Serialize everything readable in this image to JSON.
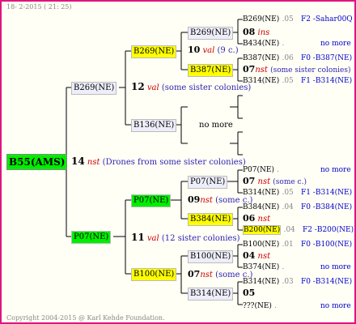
{
  "header": {
    "date": "18-  2-2015 ( 21: 25)"
  },
  "footer": {
    "copyright": "Copyright 2004-2015 @ Karl Kehde Foundation."
  },
  "root": {
    "id": "B55(AMS)"
  },
  "gen1": {
    "sire": {
      "id": "B269(NE)",
      "year": "12",
      "sym": "val",
      "note": "(some sister colonies)"
    },
    "drones": {
      "year": "14",
      "sym": "nst",
      "note": "(Drones from some sister colonies)"
    },
    "dam": {
      "id": "P07(NE)",
      "year": "11",
      "sym": "val",
      "note": "(12 sister colonies)"
    }
  },
  "gen2": {
    "a": {
      "id": "B269(NE)",
      "year": "10",
      "sym": "val",
      "note": "(9 c.)"
    },
    "b": {
      "id": "B136(NE)",
      "note": "no more"
    },
    "c": {
      "id": "P07(NE)",
      "year": "09",
      "sym": "nst",
      "note": "(some c.)"
    },
    "d": {
      "id": "B100(NE)",
      "year": "07",
      "sym": "nst",
      "note": "(some c.)"
    }
  },
  "gen3": {
    "a1": {
      "id": "B269(NE)"
    },
    "a2": {
      "id": "B387(NE)",
      "year": "07",
      "sym": "nst",
      "note": "(some sister colonies)"
    },
    "c1": {
      "id": "P07(NE)"
    },
    "c2": {
      "id": "B384(NE)",
      "year": "06",
      "sym": "nst"
    },
    "d1": {
      "id": "B100(NE)",
      "year": "04",
      "sym": "nst"
    },
    "d2": {
      "id": "B314(NE)",
      "year": "05"
    }
  },
  "gen3_yr": {
    "a1": {
      "year": "08",
      "sym": "ins"
    },
    "c1": {
      "year": "07",
      "sym": "nst",
      "note": "(some c.)"
    }
  },
  "gen4": {
    "r1": {
      "id": "B269(NE)",
      "num": ".05",
      "note": "F2 -Sahar00Q"
    },
    "r2": {
      "id": "B434(NE)",
      "num": ".",
      "note": "no more"
    },
    "r3": {
      "id": "B387(NE)",
      "num": ".06",
      "note": "F0 -B387(NE)"
    },
    "r4": {
      "id": "B314(NE)",
      "num": ".05",
      "note": "F1 -B314(NE)"
    },
    "r5": {
      "id": "P07(NE)",
      "num": ".",
      "note": "no more"
    },
    "r6": {
      "id": "B314(NE)",
      "num": ".05",
      "note": "F1 -B314(NE)"
    },
    "r7": {
      "id": "B384(NE)",
      "num": ".04",
      "note": "F0 -B384(NE)"
    },
    "r8": {
      "id": "B200(NE)",
      "num": ".04",
      "note": "F2 -B200(NE)"
    },
    "r9": {
      "id": "B100(NE)",
      "num": ".01",
      "note": "F0 -B100(NE)"
    },
    "r10": {
      "id": "B374(NE)",
      "num": ".",
      "note": "no more"
    },
    "r11": {
      "id": "B314(NE)",
      "num": ".03",
      "note": "F0 -B314(NE)"
    },
    "r12": {
      "id": "???(NE)",
      "num": ".",
      "note": "no more"
    }
  },
  "colors": {
    "border": "#e0157f",
    "yellow": "#ffff00",
    "green": "#00ee00",
    "lavender": "#eeeefa",
    "accent": "#cc0000",
    "note": "#2a1fb0"
  }
}
